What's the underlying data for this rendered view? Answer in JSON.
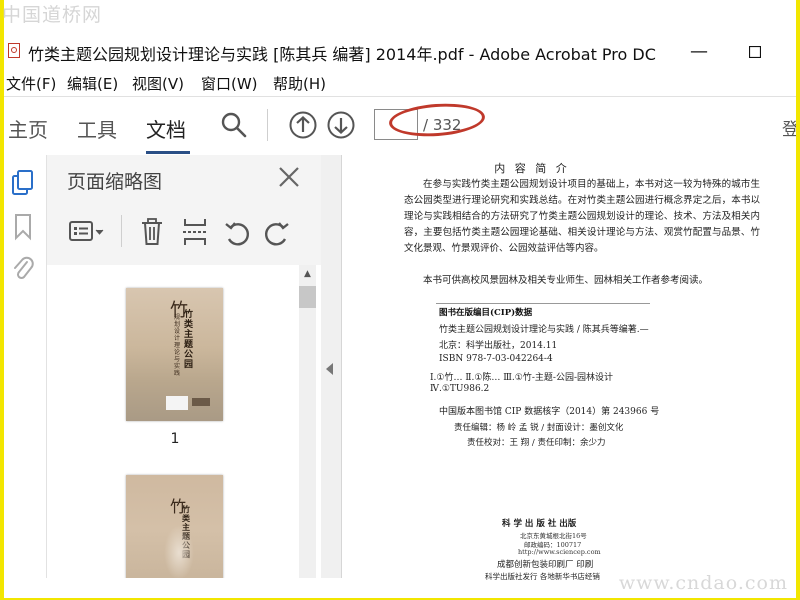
{
  "watermark": {
    "top": "中国道桥网",
    "bottom": "www.cndao.com"
  },
  "window": {
    "title": "竹类主题公园规划设计理论与实践 [陈其兵 编著] 2014年.pdf - Adobe Acrobat Pro DC",
    "minimize": "—",
    "maximize": "☐"
  },
  "menu": [
    "文件(F)",
    "编辑(E)",
    "视图(V)",
    "窗口(W)",
    "帮助(H)"
  ],
  "toolbar": {
    "tabs": [
      "主页",
      "工具",
      "文档"
    ],
    "active_tab": "文档",
    "page_current": "",
    "page_total": "/ 332",
    "right_clip": "登"
  },
  "thumbnails": {
    "title": "页面缩略图",
    "pages": [
      {
        "label": "1",
        "cover_text": "竹类主题公园",
        "cover_sub": "规划设计理论与实践"
      },
      {
        "label": "",
        "cover_text": "竹类主题公园",
        "cover_sub": "规划设计理论与实践"
      }
    ]
  },
  "document": {
    "heading": "内 容 简 介",
    "para1": "在参与实践竹类主题公园规划设计项目的基础上，本书对这一较为特殊的城市生态公园类型进行理论研究和实践总结。在对竹类主题公园进行概念界定之后，本书以理论与实践相结合的方法研究了竹类主题公园规划设计的理论、技术、方法及相关内容，主要包括竹类主题公园理论基础、相关设计理论与方法、观赏竹配置与品景、竹文化景观、竹景观评价、公园效益评估等内容。",
    "para2": "本书可供高校风景园林及相关专业师生、园林相关工作者参考阅读。",
    "cip_heading": "图书在版编目(CIP)数据",
    "cip_lines": [
      "竹类主题公园规划设计理论与实践 / 陈其兵等编著.—",
      "北京：科学出版社，2014.11",
      "ISBN 978-7-03-042264-4",
      "Ⅰ.①竹…   Ⅱ.①陈…   Ⅲ.①竹-主题-公园-园林设计",
      "Ⅳ.①TU986.2",
      "中国版本图书馆 CIP 数据核字（2014）第 243966 号"
    ],
    "editors": "责任编辑：杨 岭 孟 锐 / 封面设计：墨创文化",
    "proof": "责任校对：王 翔 / 责任印制：余少力",
    "publisher": "科 学 出 版 社 出版",
    "address1": "北京东黄城根北街16号",
    "address2": "邮政编码：100717",
    "website": "http://www.sciencep.com",
    "printer": "成都创新包装印刷厂 印刷",
    "distributor": "科学出版社发行  各地新华书店经销"
  },
  "colors": {
    "accent": "#2a4f86",
    "annotation": "#c0392b",
    "frame": "#f2e600"
  }
}
